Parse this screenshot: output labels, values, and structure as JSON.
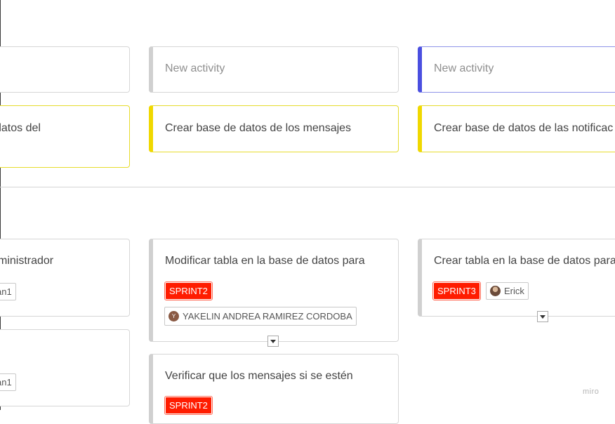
{
  "row1": {
    "activities": [
      {
        "label": ""
      },
      {
        "label": "New activity"
      },
      {
        "label": "New activity"
      }
    ],
    "tasks": [
      {
        "label": "datos del"
      },
      {
        "label": "Crear base de datos de los mensajes"
      },
      {
        "label": "Crear base de datos de las notificac"
      }
    ]
  },
  "row2": {
    "col1": {
      "card1_text": "ministrador",
      "card1_chip": "an1",
      "card2_chip": "an1"
    },
    "col2": {
      "card1_text": "Modificar tabla en la base de datos para",
      "card1_tag": "SPRINT2",
      "card1_assignee_initial": "Y",
      "card1_assignee": "YAKELIN ANDREA RAMIREZ CORDOBA",
      "card2_text": "Verificar que los mensajes si se estén",
      "card2_tag": "SPRINT2"
    },
    "col3": {
      "card1_text": "Crear tabla en la base de datos para",
      "card1_tag": "SPRINT3",
      "card1_assignee": "Erick"
    }
  },
  "colors": {
    "activity_border": "#d0d0d0",
    "activity_selected_border": "#4a4fe0",
    "task_border": "#e8e028",
    "tag_red": "#ff1c00"
  },
  "watermark": "miro"
}
